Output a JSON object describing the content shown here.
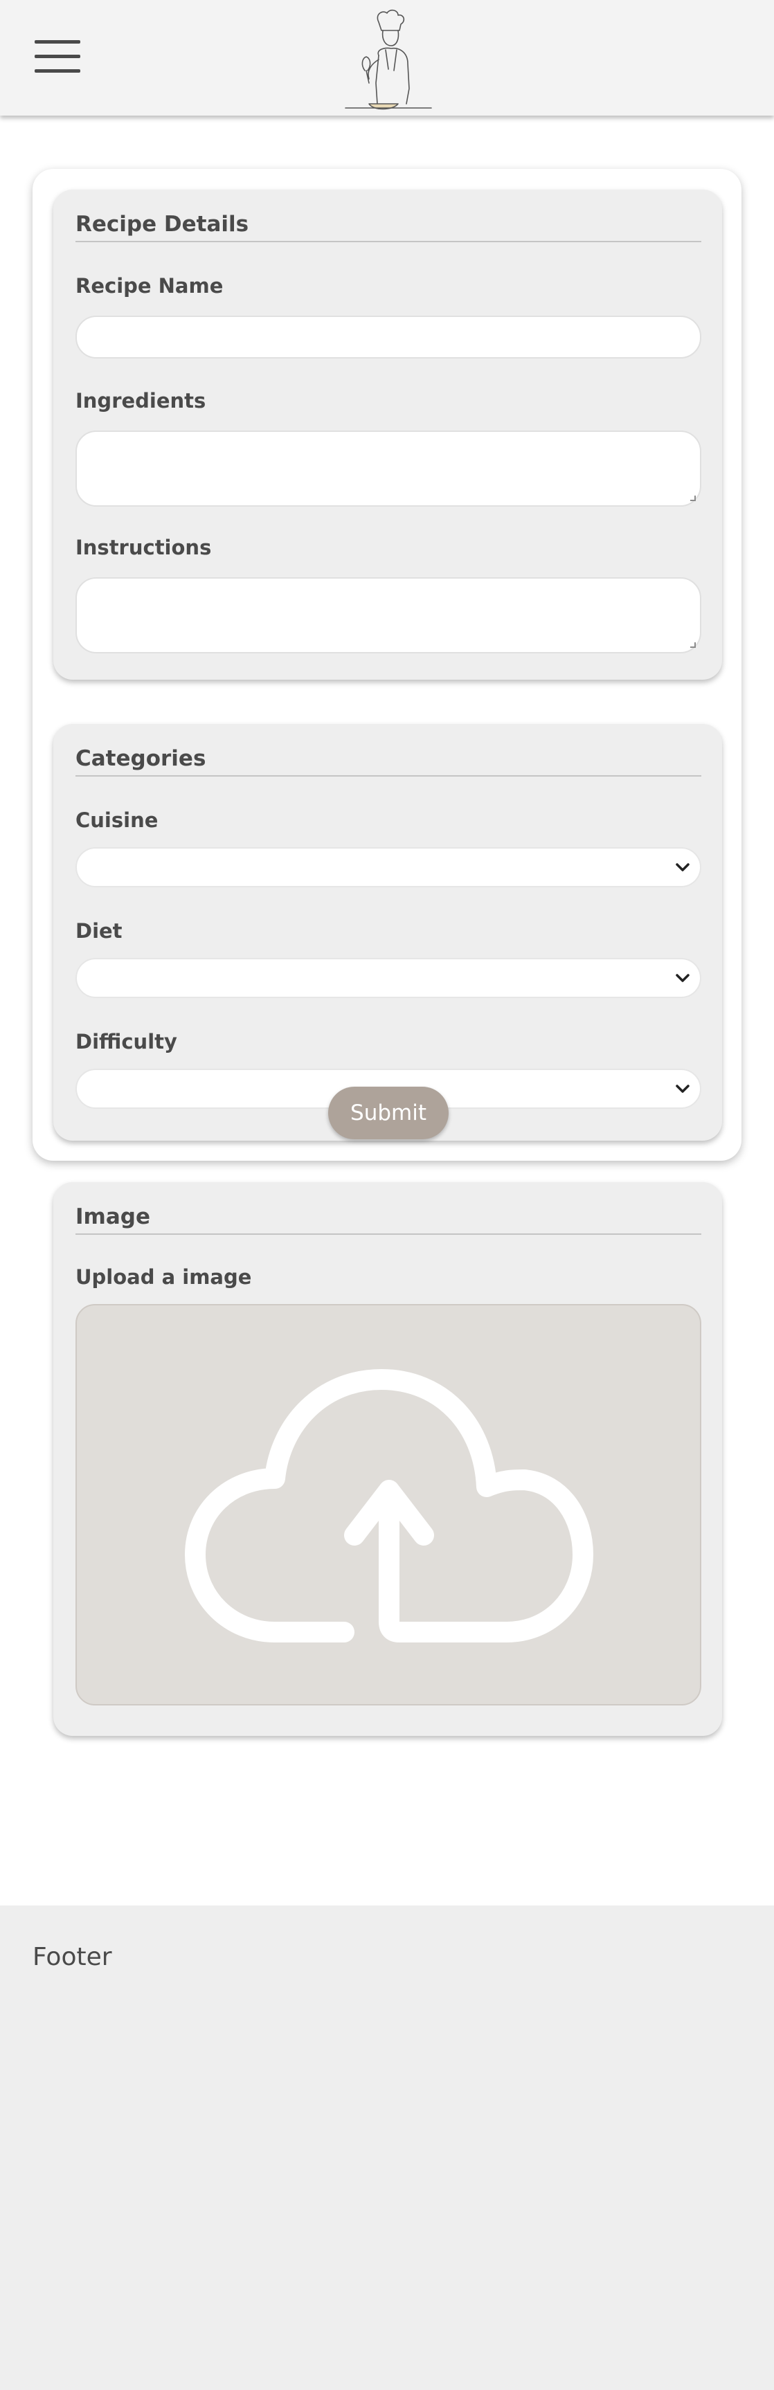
{
  "header": {
    "menu_icon": "hamburger-menu-icon",
    "logo_icon": "chef-logo-icon"
  },
  "form": {
    "recipe_details": {
      "title": "Recipe Details",
      "recipe_name_label": "Recipe Name",
      "recipe_name_value": "",
      "ingredients_label": "Ingredients",
      "ingredients_value": "",
      "instructions_label": "Instructions",
      "instructions_value": ""
    },
    "categories": {
      "title": "Categories",
      "cuisine_label": "Cuisine",
      "cuisine_value": "",
      "diet_label": "Diet",
      "diet_value": "",
      "difficulty_label": "Difficulty",
      "difficulty_value": ""
    },
    "image": {
      "title": "Image",
      "upload_label": "Upload a image",
      "upload_icon": "cloud-upload-icon"
    },
    "submit_label": "Submit"
  },
  "footer": {
    "text": "Footer"
  },
  "colors": {
    "topbar_bg": "#f3f3f3",
    "section_bg": "#eeeeee",
    "dropzone_bg": "#e0ddd9",
    "submit_bg": "#aea39a",
    "text": "#4a4a4a"
  }
}
